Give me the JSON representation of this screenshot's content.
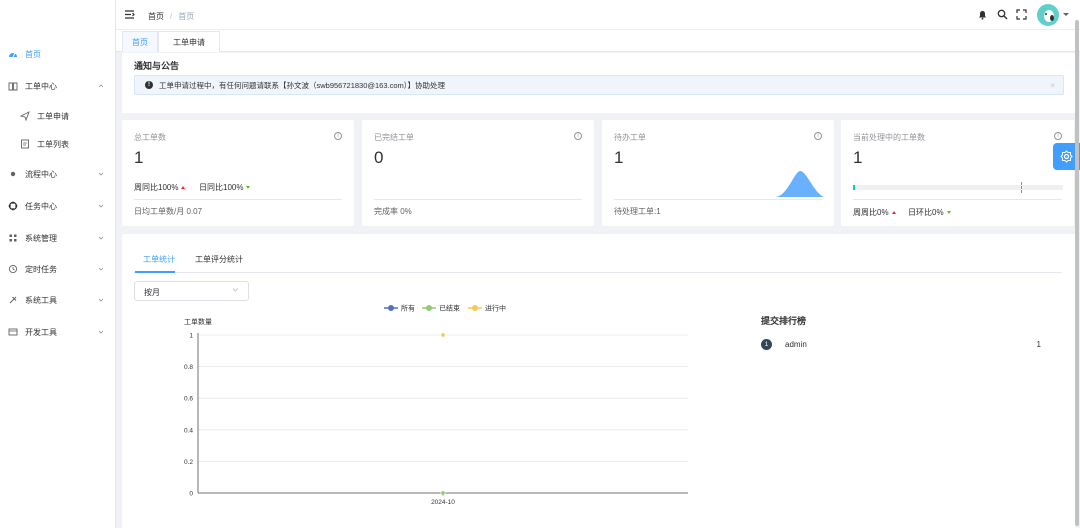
{
  "sidebar": {
    "items": [
      {
        "label": "首页",
        "icon": "dashboard-icon",
        "active": true
      },
      {
        "label": "工单中心",
        "icon": "book-icon",
        "expanded": true
      },
      {
        "label": "工单申请",
        "icon": "send-icon",
        "sub": true
      },
      {
        "label": "工单列表",
        "icon": "list-icon",
        "sub": true
      },
      {
        "label": "流程中心",
        "icon": "dot-icon"
      },
      {
        "label": "任务中心",
        "icon": "target-icon"
      },
      {
        "label": "系统管理",
        "icon": "grid-icon"
      },
      {
        "label": "定时任务",
        "icon": "clock-icon"
      },
      {
        "label": "系统工具",
        "icon": "tool-icon"
      },
      {
        "label": "开发工具",
        "icon": "code-icon"
      }
    ]
  },
  "header": {
    "breadcrumb": [
      "首页",
      "首页"
    ]
  },
  "tags": [
    "首页",
    "工单申请"
  ],
  "notice": {
    "title": "通知与公告",
    "message": "工单申请过程中，有任何问题请联系【孙文波（swb956721830@163.com）】协助处理",
    "close": "×"
  },
  "cards": {
    "total": {
      "title": "总工单数",
      "value": "1",
      "week": "周同比100%",
      "day": "日同比100%",
      "footer": "日均工单数/月 0.07"
    },
    "done": {
      "title": "已完结工单",
      "value": "0",
      "footer": "完成率 0%"
    },
    "todo": {
      "title": "待办工单",
      "value": "1",
      "footer": "待处理工单:1"
    },
    "current": {
      "title": "当前处理中的工单数",
      "value": "1",
      "progress": 0.01,
      "target": 0.8,
      "week": "周周比0%",
      "day": "日环比0%"
    }
  },
  "panel": {
    "tabs": [
      "工单统计",
      "工单评分统计"
    ],
    "select_value": "按月",
    "rank_title": "提交排行榜",
    "rank": [
      {
        "no": "1",
        "name": "admin",
        "value": "1"
      }
    ]
  },
  "chart_data": {
    "type": "line",
    "categories": [
      "2024-10"
    ],
    "series": [
      {
        "name": "所有",
        "color": "#5470c6",
        "values": [
          1
        ]
      },
      {
        "name": "已结束",
        "color": "#91cc75",
        "values": [
          0
        ]
      },
      {
        "name": "进行中",
        "color": "#fac858",
        "values": [
          1
        ]
      }
    ],
    "ylabel": "工单数量",
    "ylim": [
      0,
      1
    ],
    "yticks": [
      "0",
      "0.2",
      "0.4",
      "0.6",
      "0.8",
      "1"
    ],
    "legend": "top-center",
    "grid": true
  },
  "colors": {
    "primary": "#409eff",
    "teal": "#13c2c2",
    "area": "#69b1ff"
  }
}
